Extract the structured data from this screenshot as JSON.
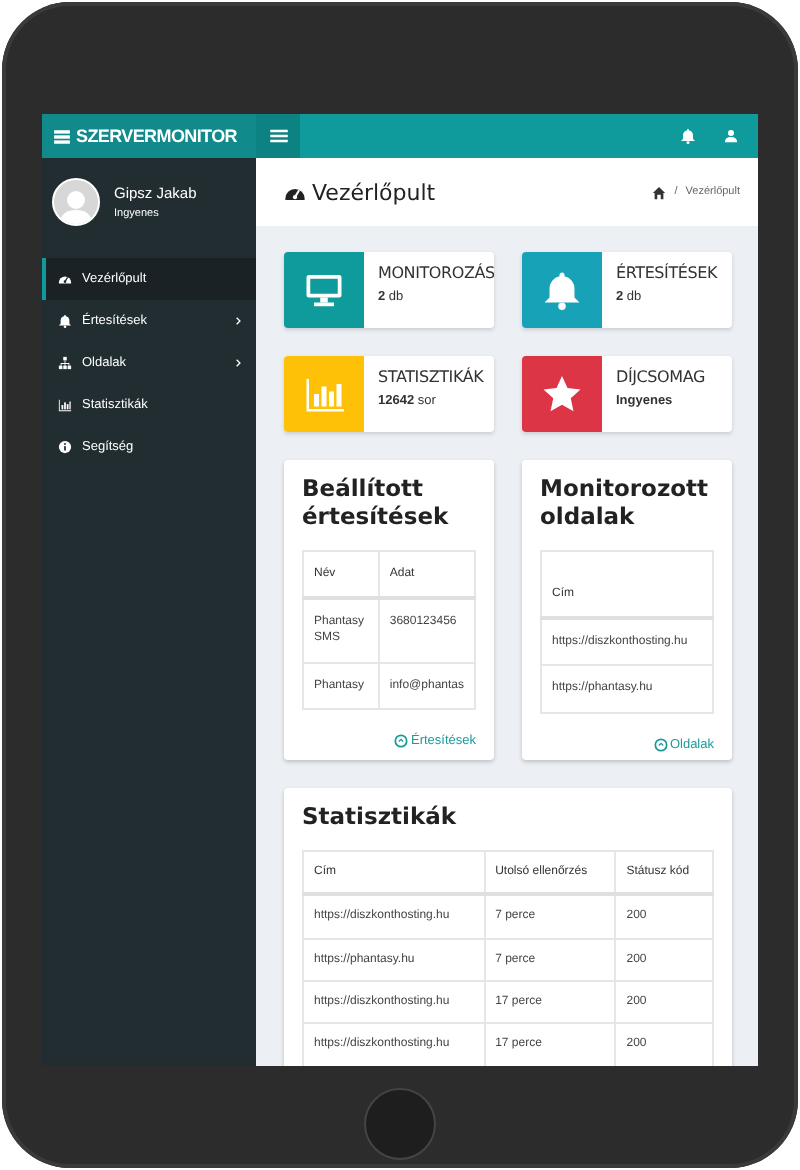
{
  "brand": "SZERVERMONITOR",
  "user": {
    "name": "Gipsz Jakab",
    "plan": "Ingyenes"
  },
  "sidebar": {
    "items": [
      {
        "label": "Vezérlőpult",
        "selected": true,
        "expandable": false
      },
      {
        "label": "Értesítések",
        "selected": false,
        "expandable": true
      },
      {
        "label": "Oldalak",
        "selected": false,
        "expandable": true
      },
      {
        "label": "Statisztikák",
        "selected": false,
        "expandable": false
      },
      {
        "label": "Segítség",
        "selected": false,
        "expandable": false
      }
    ]
  },
  "page": {
    "title": "Vezérlőpult",
    "breadcrumb_separator": "/",
    "breadcrumb": [
      "Vezérlőpult"
    ]
  },
  "info_boxes": [
    {
      "title": "MONITOROZÁS",
      "value": "**2** db",
      "color": "#0f9a9b"
    },
    {
      "title": "ÉRTESÍTÉSEK",
      "value": "**2** db",
      "color": "#17a2b8"
    },
    {
      "title": "STATISZTIKÁK",
      "value": "**12642** sor",
      "color": "#ffc107"
    },
    {
      "title": "DÍJCSOMAG",
      "value": "**Ingyenes**",
      "color": "#dc3545"
    }
  ],
  "cards": [
    {
      "title": "Beállított értesítések",
      "columns": [
        "Név",
        "Adat"
      ],
      "rows": [
        [
          "Phantasy SMS",
          "3680123456"
        ],
        [
          "Phantasy",
          "info@phantas"
        ]
      ],
      "link": "Értesítések"
    },
    {
      "title": "Monitorozott oldalak",
      "columns": [
        "Cím"
      ],
      "rows": [
        [
          "https://diszkonthosting.hu"
        ],
        [
          "https://phantasy.hu"
        ]
      ],
      "link": "Oldalak"
    }
  ],
  "stats": {
    "title": "Statisztikák",
    "columns": [
      "Cím",
      "Utolsó ellenőrzés",
      "Státusz kód"
    ],
    "rows": [
      [
        "https://diszkonthosting.hu",
        "7 perce",
        "200"
      ],
      [
        "https://phantasy.hu",
        "7 perce",
        "200"
      ],
      [
        "https://diszkonthosting.hu",
        "17 perce",
        "200"
      ],
      [
        "https://diszkonthosting.hu",
        "17 perce",
        "200"
      ]
    ]
  }
}
